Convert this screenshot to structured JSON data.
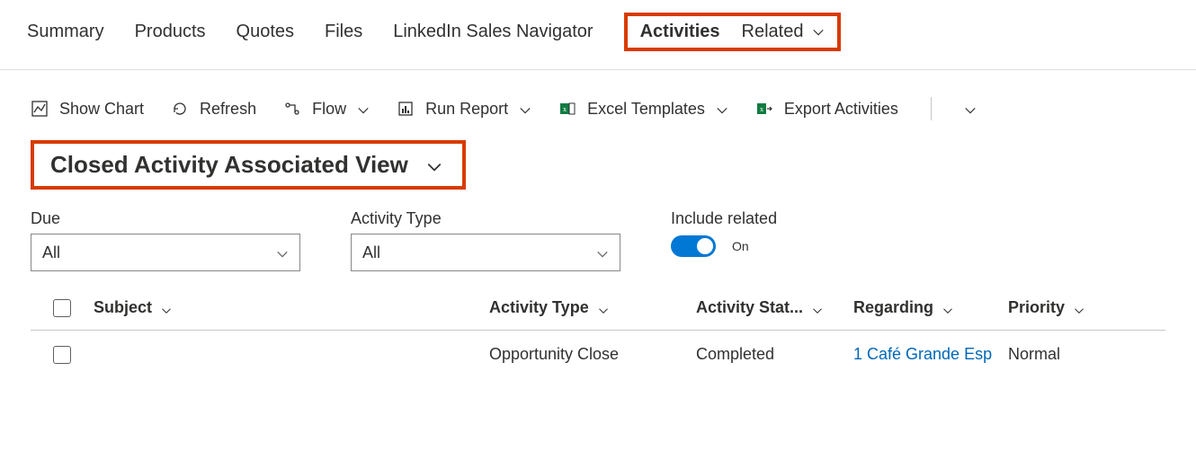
{
  "tabs": {
    "summary": "Summary",
    "products": "Products",
    "quotes": "Quotes",
    "files": "Files",
    "linkedin": "LinkedIn Sales Navigator",
    "activities": "Activities",
    "related": "Related"
  },
  "toolbar": {
    "show_chart": "Show Chart",
    "refresh": "Refresh",
    "flow": "Flow",
    "run_report": "Run Report",
    "excel_templates": "Excel Templates",
    "export_activities": "Export Activities"
  },
  "view": {
    "title": "Closed Activity Associated View"
  },
  "filters": {
    "due_label": "Due",
    "due_value": "All",
    "type_label": "Activity Type",
    "type_value": "All",
    "include_label": "Include related",
    "include_state": "On"
  },
  "columns": {
    "subject": "Subject",
    "activity_type": "Activity Type",
    "activity_status": "Activity Stat...",
    "regarding": "Regarding",
    "priority": "Priority"
  },
  "rows": [
    {
      "subject": "",
      "activity_type": "Opportunity Close",
      "activity_status": "Completed",
      "regarding": "1 Café Grande Esp",
      "priority": "Normal"
    }
  ]
}
